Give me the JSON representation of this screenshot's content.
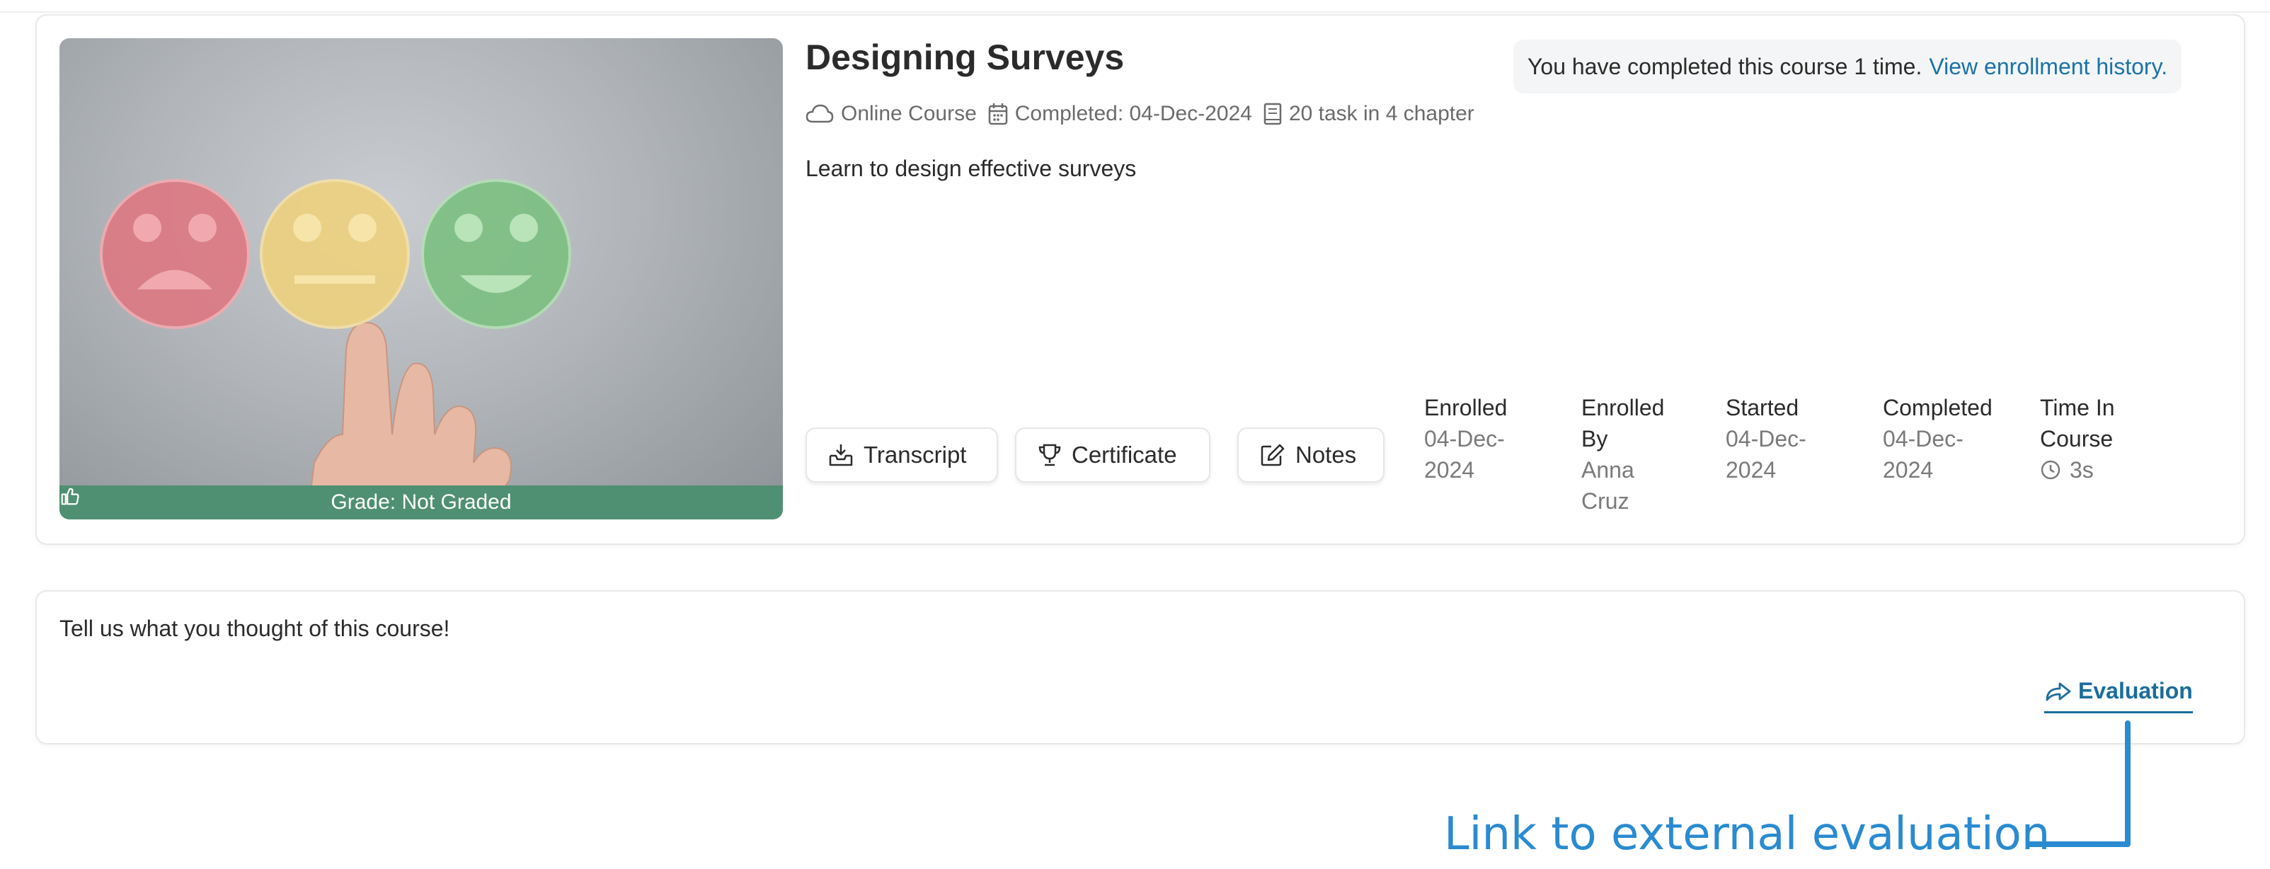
{
  "course": {
    "title": "Designing Surveys",
    "completion_note": "You have completed this course 1 time.",
    "enrollment_history_link": "View enrollment history.",
    "meta": {
      "type": "Online Course",
      "completed": "Completed: 04-Dec-2024",
      "tasks": "20 task in 4 chapter"
    },
    "description": "Learn to design effective surveys",
    "grade": "Grade: Not Graded",
    "buttons": {
      "transcript": "Transcript",
      "certificate": "Certificate",
      "notes": "Notes"
    },
    "stats": {
      "enrolled_label": "Enrolled",
      "enrolled_value": "04-Dec-2024",
      "enrolled_by_label": "Enrolled By",
      "enrolled_by_value": "Anna Cruz",
      "started_label": "Started",
      "started_value": "04-Dec-2024",
      "completed_label": "Completed",
      "completed_value": "04-Dec-2024",
      "time_label": "Time In Course",
      "time_value": "3s"
    }
  },
  "feedback": {
    "prompt": "Tell us what you thought of this course!",
    "evaluation_link": "Evaluation"
  },
  "annotation": {
    "text": "Link to external evaluation"
  },
  "colors": {
    "link": "#1a73a8",
    "grade_bar": "#4f8f72",
    "annotation": "#2a8bd0"
  }
}
